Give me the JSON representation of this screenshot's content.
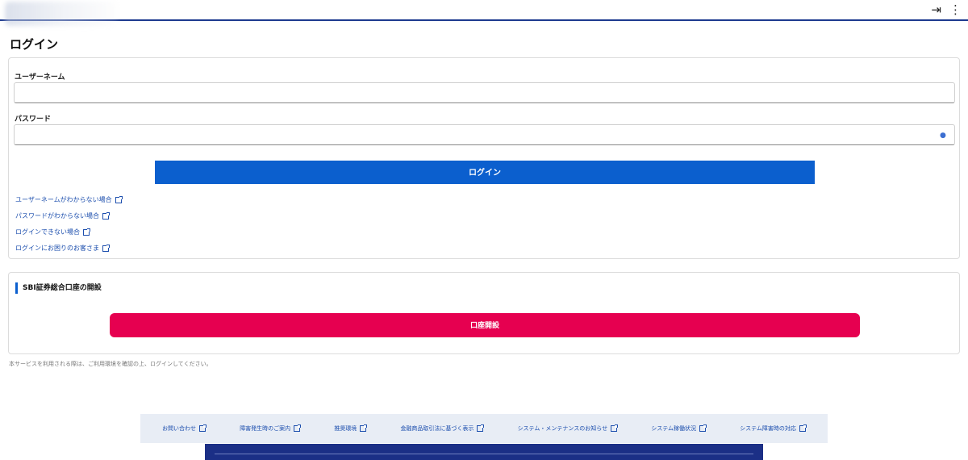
{
  "header": {
    "icons": [
      "login-icon",
      "kebab-menu-icon"
    ]
  },
  "page": {
    "title": "ログイン"
  },
  "login_form": {
    "username_label": "ユーザーネーム",
    "username_value": "",
    "password_label": "パスワード",
    "password_value": "",
    "login_button": "ログイン",
    "help_links": [
      "ユーザーネームがわからない場合",
      "パスワードがわからない場合",
      "ログインできない場合",
      "ログインにお困りのお客さま"
    ]
  },
  "account_section": {
    "heading": "SBI証券総合口座の開設",
    "button": "口座開設"
  },
  "notice": "本サービスを利用される際は、ご利用環境を確認の上、ログインしてください。",
  "footer": {
    "links": [
      "お問い合わせ",
      "障害発生時のご案内",
      "推奨環境",
      "金融商品取引法に基づく表示",
      "システム・メンテナンスのお知らせ",
      "システム稼働状況",
      "システム障害時の対応"
    ]
  }
}
